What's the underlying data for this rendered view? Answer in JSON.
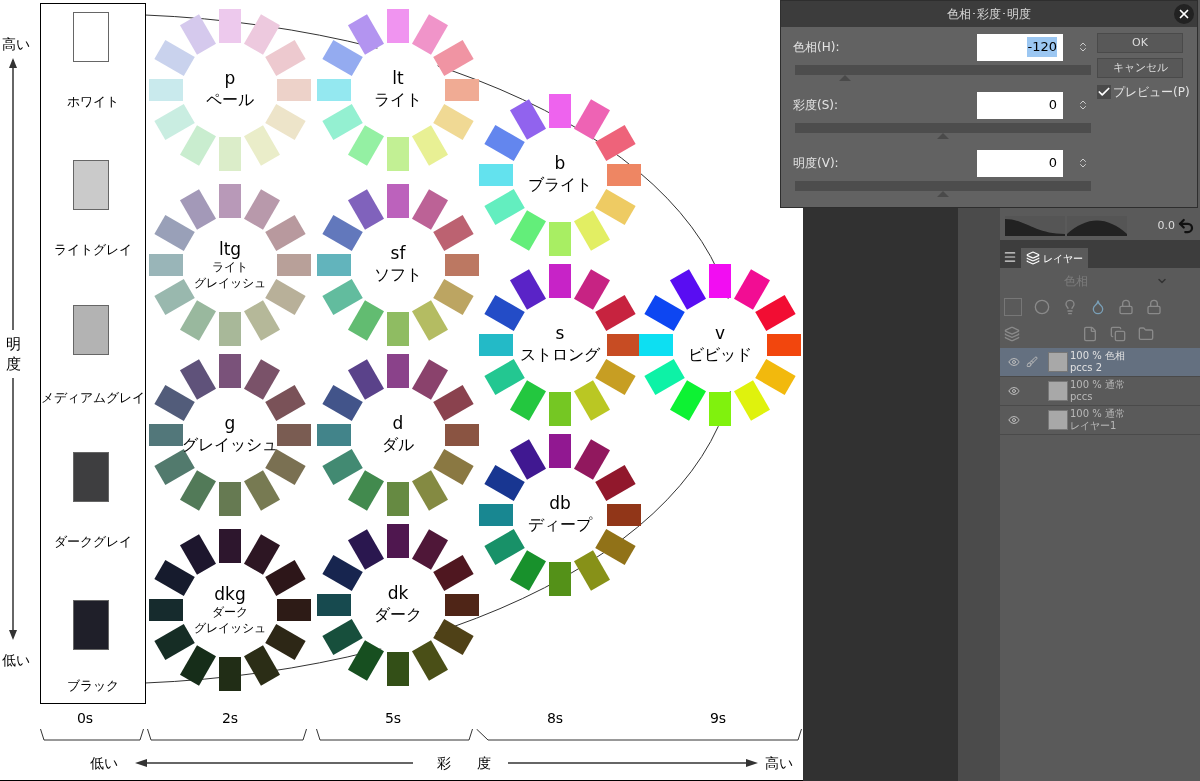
{
  "lightness_axis": {
    "high": "高い",
    "label": [
      "明",
      "度"
    ],
    "low": "低い"
  },
  "achromatic": [
    {
      "name": "ホワイト",
      "color": "#ffffff"
    },
    {
      "name": "ライトグレイ",
      "color": "#cacaca"
    },
    {
      "name": "メディアムグレイ",
      "color": "#b3b3b3"
    },
    {
      "name": "ダークグレイ",
      "color": "#3e3e40"
    },
    {
      "name": "ブラック",
      "color": "#1f1f29"
    }
  ],
  "tones": [
    {
      "abbr": "p",
      "name": [
        "ペール"
      ]
    },
    {
      "abbr": "lt",
      "name": [
        "ライト"
      ]
    },
    {
      "abbr": "b",
      "name": [
        "ブライト"
      ]
    },
    {
      "abbr": "ltg",
      "name": [
        "ライト",
        "グレイッシュ"
      ]
    },
    {
      "abbr": "sf",
      "name": [
        "ソフト"
      ]
    },
    {
      "abbr": "s",
      "name": [
        "ストロング"
      ]
    },
    {
      "abbr": "v",
      "name": [
        "ビビッド"
      ]
    },
    {
      "abbr": "g",
      "name": [
        "グレイッシュ"
      ]
    },
    {
      "abbr": "d",
      "name": [
        "ダル"
      ]
    },
    {
      "abbr": "db",
      "name": [
        "ディープ"
      ]
    },
    {
      "abbr": "dkg",
      "name": [
        "ダーク",
        "グレイッシュ"
      ]
    },
    {
      "abbr": "dk",
      "name": [
        "ダーク"
      ]
    }
  ],
  "saturation_scale": [
    "0s",
    "2s",
    "5s",
    "8s",
    "9s"
  ],
  "saturation_axis": {
    "low": "低い",
    "label": [
      "彩",
      "度"
    ],
    "high": "高い"
  },
  "dialog": {
    "title": "色相･彩度･明度",
    "fields": [
      {
        "label": "色相(H):",
        "value": "-120",
        "level": 0.17
      },
      {
        "label": "彩度(S):",
        "value": "0",
        "level": 0.5
      },
      {
        "label": "明度(V):",
        "value": "0",
        "level": 0.5
      }
    ],
    "buttons": [
      "OK",
      "キャンセル"
    ],
    "preview": {
      "label": "プレビュー(P)",
      "checked": true
    }
  },
  "panel": {
    "value": "0.0",
    "tab": "レイヤー",
    "blend_mode": "色相",
    "layers": [
      {
        "mode": "100 % 色相",
        "name": "pccs 2",
        "selected": true
      },
      {
        "mode": "100 % 通常",
        "name": "pccs",
        "selected": false
      },
      {
        "mode": "100 % 通常",
        "name": "レイヤー1",
        "selected": false
      }
    ]
  }
}
